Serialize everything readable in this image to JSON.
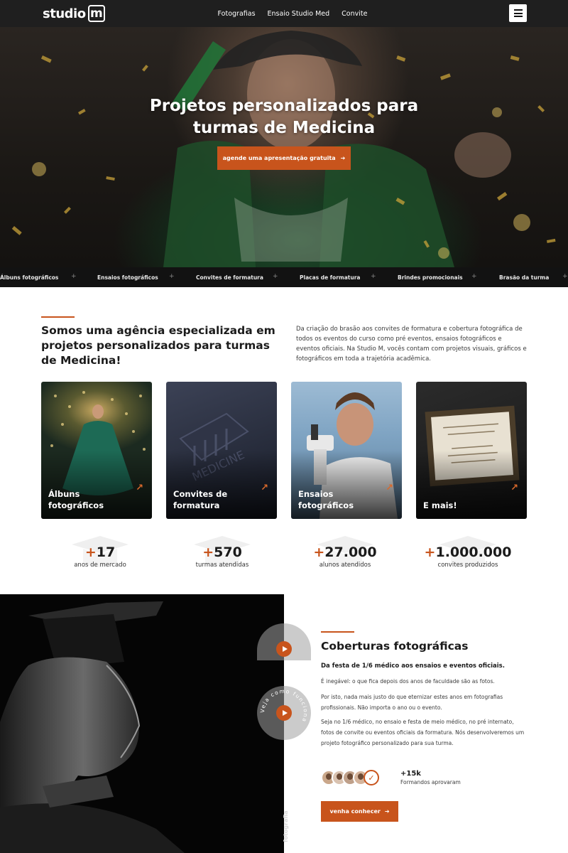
{
  "nav": {
    "logo_text": "studio",
    "logo_mark": "m",
    "links": [
      "Fotografias",
      "Ensaio Studio Med",
      "Convite"
    ],
    "menu_icon": "hamburger-menu-icon"
  },
  "hero": {
    "title_line1": "Projetos personalizados para",
    "title_line2": "turmas de Medicina",
    "cta_label": "agende uma apresentação gratuita",
    "cta_icon": "arrow-right-icon"
  },
  "services_strip": [
    "Álbuns fotográficos",
    "Ensaios fotográficos",
    "Convites de formatura",
    "Placas de formatura",
    "Brindes promocionais",
    "Brasão da turma"
  ],
  "about": {
    "heading": "Somos uma agência especializada em projetos personalizados para turmas de Medicina!",
    "paragraph": "Da criação do brasão aos convites de formatura e cobertura fotográfica de todos os eventos do curso como pré eventos, ensaios fotográficos e eventos oficiais. Na Studio M, vocês contam com projetos visuais, gráficos e fotográficos em toda a trajetória acadêmica."
  },
  "cards": [
    {
      "label": "Álbuns fotográficos"
    },
    {
      "label": "Convites de formatura"
    },
    {
      "label": "Ensaios fotográficos"
    },
    {
      "label": "E mais!"
    }
  ],
  "stats": [
    {
      "plus": "+",
      "value": "17",
      "label": "anos de mercado"
    },
    {
      "plus": "+",
      "value": "570",
      "label": "turmas atendidas"
    },
    {
      "plus": "+",
      "value": "27.000",
      "label": "alunos atendidos"
    },
    {
      "plus": "+",
      "value": "1.000.000",
      "label": "convites produzidos"
    }
  ],
  "coverage": {
    "badge_text": "Veja como funciona",
    "heading": "Coberturas fotográficas",
    "subheading": "Da festa de 1/6 médico aos ensaios e eventos oficiais.",
    "p1": "É inegável: o que fica depois dos anos de faculdade são as fotos.",
    "p2": "Por isto, nada mais justo do que eternizar estes anos em fotografias profissionais. Não importa o ano ou o evento.",
    "p3": "Seja no 1/6 médico, no ensaio e festa de meio médico, no pré internato, fotos de convite ou eventos oficiais da formatura. Nós desenvolveremos um projeto fotográfico personalizado para sua turma.",
    "count": "+15k",
    "count_label": "Formandos aprovaram",
    "button_label": "venha conhecer",
    "vertical_text": "fotografia"
  },
  "colors": {
    "accent": "#c8541c",
    "dark": "#1f1f1f",
    "strip": "#121212"
  }
}
